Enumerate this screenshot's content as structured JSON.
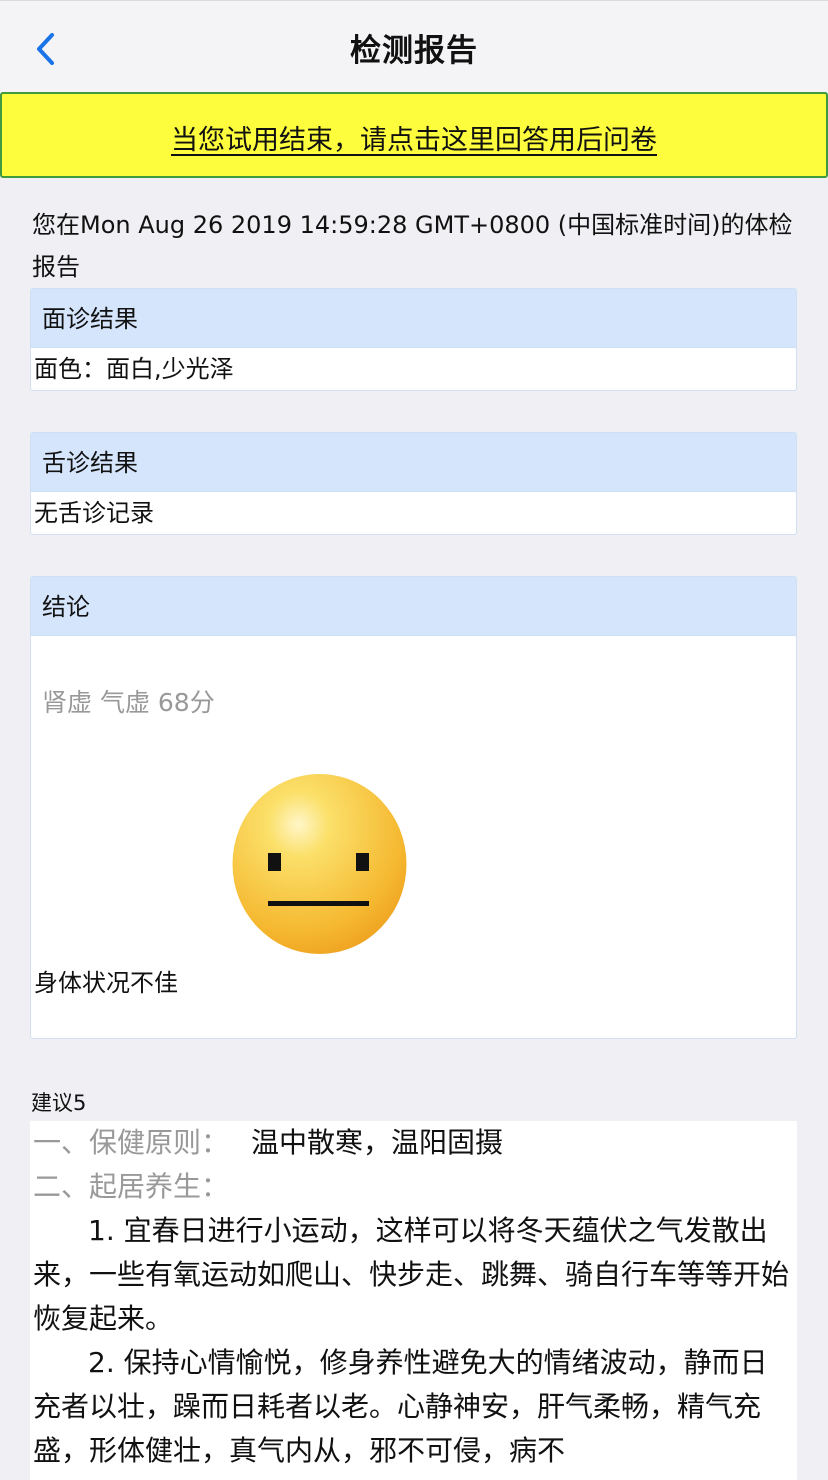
{
  "header": {
    "title": "检测报告"
  },
  "banner": {
    "text": "当您试用结束，请点击这里回答用后问卷"
  },
  "report": {
    "intro": "您在Mon Aug 26 2019 14:59:28 GMT+0800 (中国标准时间)的体检报告"
  },
  "face_result": {
    "title": "面诊结果",
    "content": "面色：面白,少光泽"
  },
  "tongue_result": {
    "title": "舌诊结果",
    "content": "无舌诊记录"
  },
  "conclusion": {
    "title": "结论",
    "score_text": "肾虚 气虚 68分",
    "status": "身体状况不佳"
  },
  "advice": {
    "title": "建议5",
    "principle_label": "一、保健原则：",
    "principle_value": "温中散寒，温阳固摄",
    "daily_label": "二、起居养生：",
    "paragraphs": [
      "1. 宜春日进行小运动，这样可以将冬天蕴伏之气发散出来，一些有氧运动如爬山、快步走、跳舞、骑自行车等等开始恢复起来。",
      "2. 保持心情愉悦，修身养性避免大的情绪波动，静而日充者以壮，躁而日耗者以老。心静神安，肝气柔畅，精气充盛，形体健壮，真气内从，邪不可侵，病不"
    ]
  },
  "colors": {
    "banner_bg": "#fdfd3d",
    "banner_border": "#3f9b3b",
    "panel_header_bg": "#d5e5fb",
    "back_arrow": "#1a73e8",
    "face_yellow": "#f6b52a"
  },
  "icons": {
    "back": "chevron-left-icon",
    "face": "neutral-face-icon"
  }
}
